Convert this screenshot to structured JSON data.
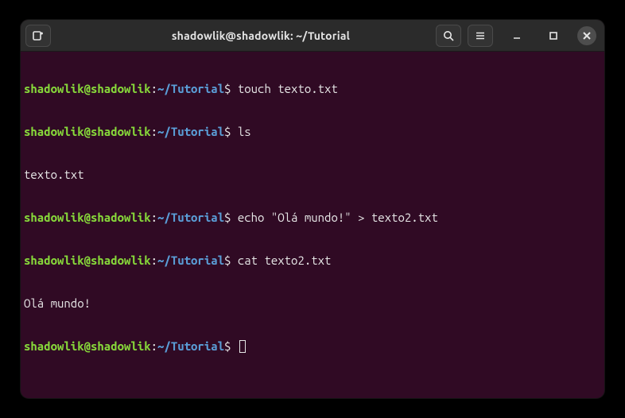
{
  "window": {
    "title": "shadowlik@shadowlik: ~/Tutorial"
  },
  "prompt": {
    "user_host": "shadowlik@shadowlik",
    "colon": ":",
    "path": "~/Tutorial",
    "dollar": "$"
  },
  "lines": {
    "l1_cmd": " touch texto.txt",
    "l2_cmd": " ls",
    "l3_out": "texto.txt",
    "l4_cmd": " echo \"Olá mundo!\" > texto2.txt",
    "l5_cmd": " cat texto2.txt",
    "l6_out": "Olá mundo!",
    "l7_cmd": " "
  },
  "icons": {
    "new_tab": "new-tab-icon",
    "search": "search-icon",
    "menu": "hamburger-menu-icon",
    "minimize": "minimize-icon",
    "maximize": "maximize-icon",
    "close": "close-icon"
  }
}
